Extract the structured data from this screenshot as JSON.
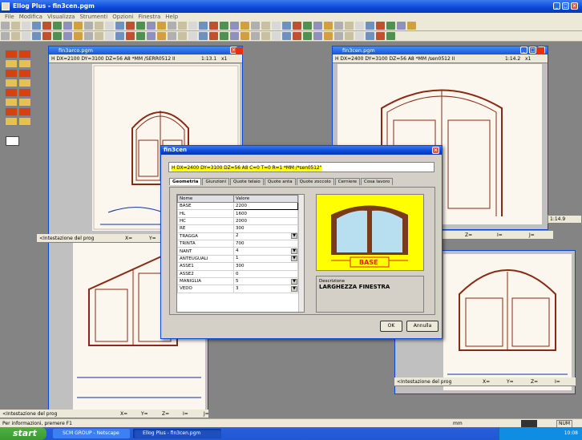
{
  "app": {
    "title": "Ellog Plus - fin3cen.pgm"
  },
  "menu": [
    "File",
    "Modifica",
    "Visualizza",
    "Strumenti",
    "Opzioni",
    "Finestra",
    "Help"
  ],
  "windows": {
    "w1": {
      "title": "fin3arco.pgm",
      "info": "H DX=2100 DY=3100 DZ=56 A8 *MM /SERR0512 II",
      "scale": "1:13.1",
      "mult": "x1"
    },
    "w2": {
      "title": "fin3cen.pgm",
      "info": "H DX=2400 DY=3100 DZ=56 A8 *MM /sen0512 II",
      "scale": "1:14.2",
      "mult": "x1",
      "side_scale": "1:14.9"
    },
    "w3": {
      "intestazione": "<Intestazione del prog",
      "cols": [
        "X=",
        "Y="
      ]
    },
    "w4": {
      "intestazione": "<Intestazione del prog",
      "cols": [
        "X=",
        "Y=",
        "Z=",
        "I=",
        "J="
      ]
    },
    "w2bar": {
      "cols": [
        "Y=",
        "Z=",
        "I=",
        "J="
      ]
    },
    "w5": {
      "intestazione": "<Intestazione del prog",
      "cols": [
        "X=",
        "Y=",
        "Z=",
        "I="
      ]
    }
  },
  "dialog": {
    "title": "fin3cen",
    "command": "H DX=2400 DY=3100 DZ=56 A8 C=0 T=0 R=1 *MM /*sen0512\"",
    "tabs": [
      "Geometria",
      "Giunzioni",
      "Quote telaio",
      "Quote anta",
      "Quote zoccolo",
      "Cerniere",
      "Cosa lavoro"
    ],
    "table_header": [
      "Nome",
      "Valore"
    ],
    "rows": [
      {
        "name": "BASE",
        "value": "2200",
        "dd": false
      },
      {
        "name": "HL",
        "value": "1600",
        "dd": false
      },
      {
        "name": "HC",
        "value": "2000",
        "dd": false
      },
      {
        "name": "RE",
        "value": "300",
        "dd": false
      },
      {
        "name": "TRAGGA",
        "value": "2",
        "dd": true
      },
      {
        "name": "TRINTA",
        "value": "700",
        "dd": false
      },
      {
        "name": "NANT",
        "value": "4",
        "dd": true
      },
      {
        "name": "ANTEUGUALI",
        "value": "1",
        "dd": true
      },
      {
        "name": "ASSE1",
        "value": "300",
        "dd": false
      },
      {
        "name": "ASSE2",
        "value": "0",
        "dd": false
      },
      {
        "name": "MANIGLIA",
        "value": "5",
        "dd": true
      },
      {
        "name": "VEDO",
        "value": "3",
        "dd": true
      }
    ],
    "preview_label": "BASE",
    "desc_label": "Descrizione",
    "desc_value": "LARGHEZZA FINESTRA",
    "ok": "OK",
    "cancel": "Annulla"
  },
  "status": {
    "text": "Per informazioni, premere F1",
    "mm": "mm",
    "num": "NUM"
  },
  "taskbar": {
    "start": "start",
    "tasks": [
      "SCM GROUP - Netscape",
      "Ellog Plus - fin3cen.pgm"
    ],
    "clock": "10:08"
  },
  "colors": {
    "accent": "#0a48d8",
    "frame": "#8b2a12",
    "highlight": "#ffff00"
  }
}
